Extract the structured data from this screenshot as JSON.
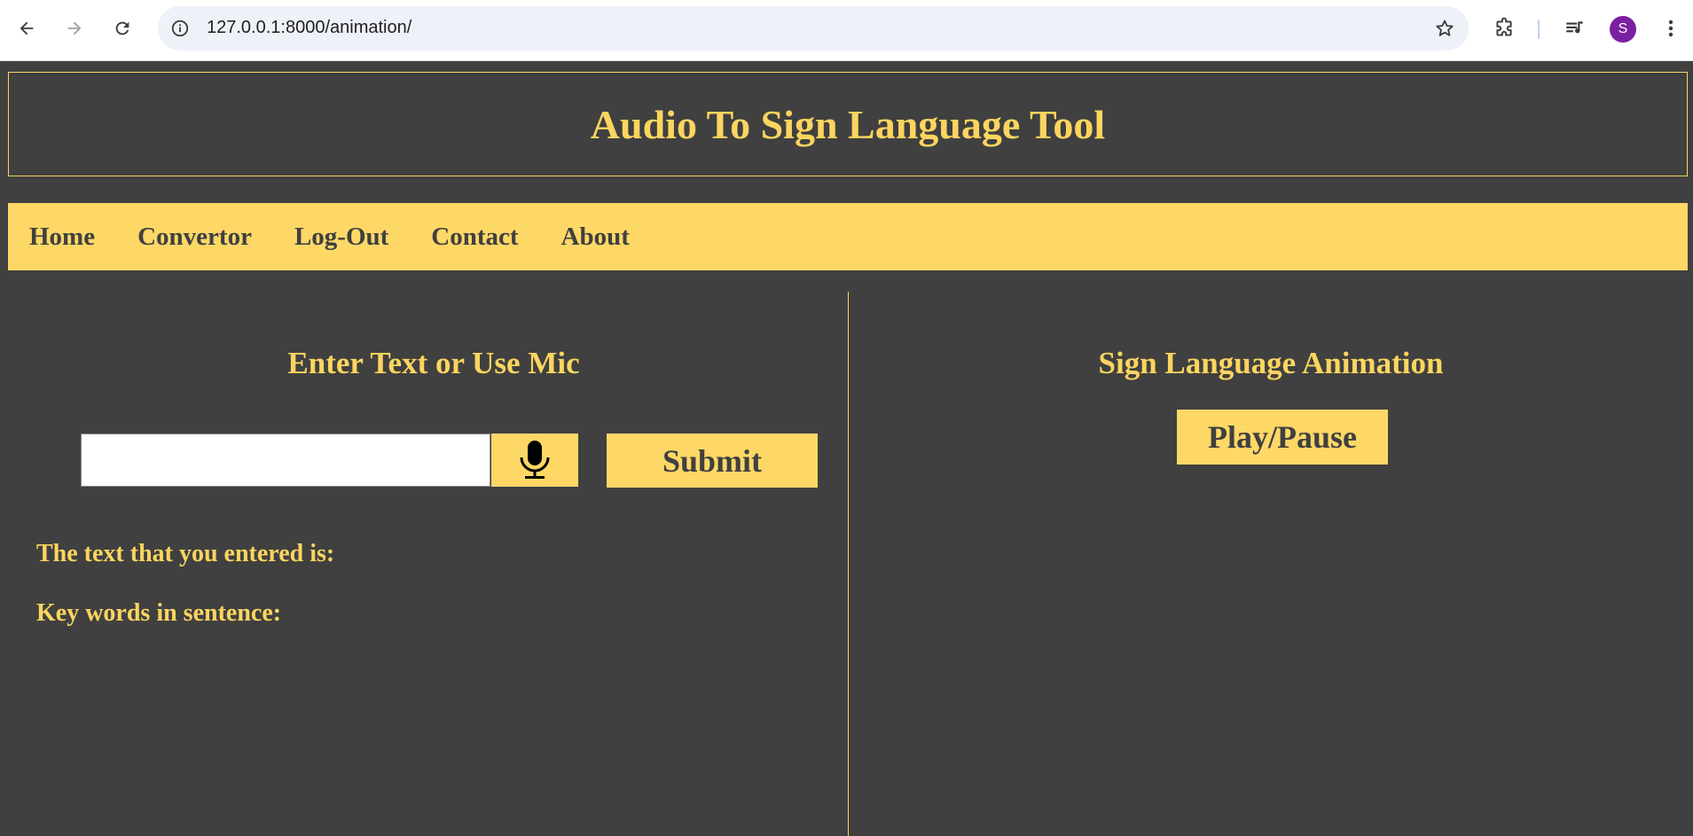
{
  "browser": {
    "url": "127.0.0.1:8000/animation/",
    "profile_initial": "S"
  },
  "header": {
    "title": "Audio To Sign Language Tool"
  },
  "nav": {
    "items": [
      {
        "label": "Home"
      },
      {
        "label": "Convertor"
      },
      {
        "label": "Log-Out"
      },
      {
        "label": "Contact"
      },
      {
        "label": "About"
      }
    ]
  },
  "left_panel": {
    "heading": "Enter Text or Use Mic",
    "input_value": "",
    "submit_label": "Submit",
    "entered_text_label": "The text that you entered is:",
    "keywords_label": "Key words in sentence:"
  },
  "right_panel": {
    "heading": "Sign Language Animation",
    "play_label": "Play/Pause"
  },
  "colors": {
    "background": "#404040",
    "accent": "#fed866",
    "accent_text": "#fcd55f",
    "avatar": "#7b1fa2"
  },
  "icons": {
    "back": "arrow-left-icon",
    "forward": "arrow-right-icon",
    "reload": "reload-icon",
    "info": "info-icon",
    "bookmark": "star-icon",
    "extensions": "puzzle-icon",
    "media": "playlist-icon",
    "menu": "kebab-menu-icon",
    "mic": "microphone-icon"
  }
}
